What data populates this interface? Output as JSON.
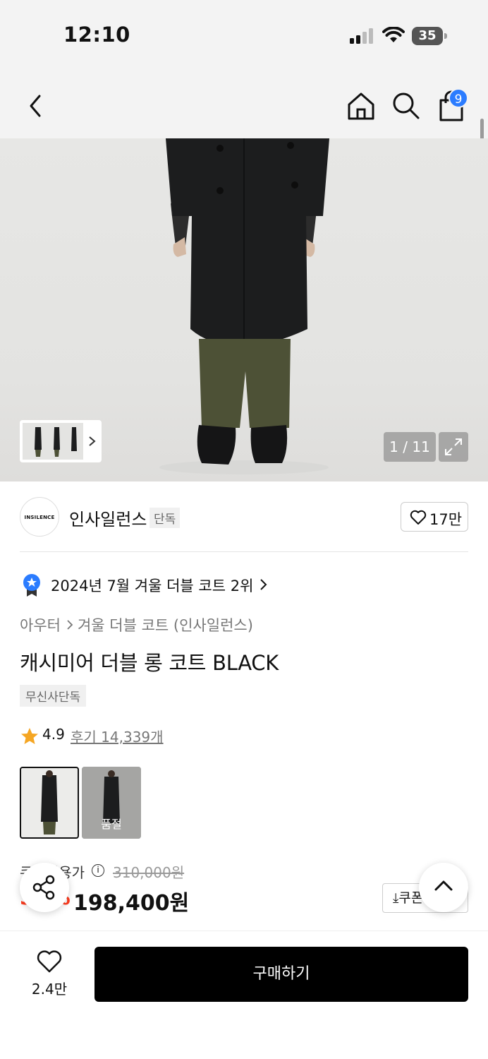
{
  "status_bar": {
    "time": "12:10",
    "battery": "35"
  },
  "nav": {
    "cart_count": "9",
    "icons": [
      "back-icon",
      "home-icon",
      "search-icon",
      "cart-icon"
    ]
  },
  "gallery": {
    "counter": "1 / 11"
  },
  "brand": {
    "logo_text": "INSILENCE",
    "name": "인사일런스",
    "tag": "단독",
    "likes": "17만"
  },
  "ranking": {
    "text": "2024년 7월 겨울 더블 코트 2위"
  },
  "breadcrumb": {
    "category": "아우터",
    "subcategory": "겨울 더블 코트 (인사일런스)"
  },
  "product": {
    "title": "캐시미어 더블 롱 코트 BLACK",
    "exclusive_tag": "무신사단독"
  },
  "rating": {
    "score": "4.9",
    "reviews": "후기 14,339개"
  },
  "colors": {
    "options": [
      {
        "label": ""
      },
      {
        "label": "품절"
      }
    ]
  },
  "price": {
    "label": "쿠폰적용가",
    "original": "310,000원",
    "discount": "36%",
    "sale": "198,400원",
    "coupon_button": "쿠폰"
  },
  "bottom_bar": {
    "likes": "2.4만",
    "buy_label": "구매하기"
  },
  "colors_theme": {
    "accent": "#2b7cff",
    "discount": "#ff3c1f",
    "buy_bg": "#000000"
  }
}
